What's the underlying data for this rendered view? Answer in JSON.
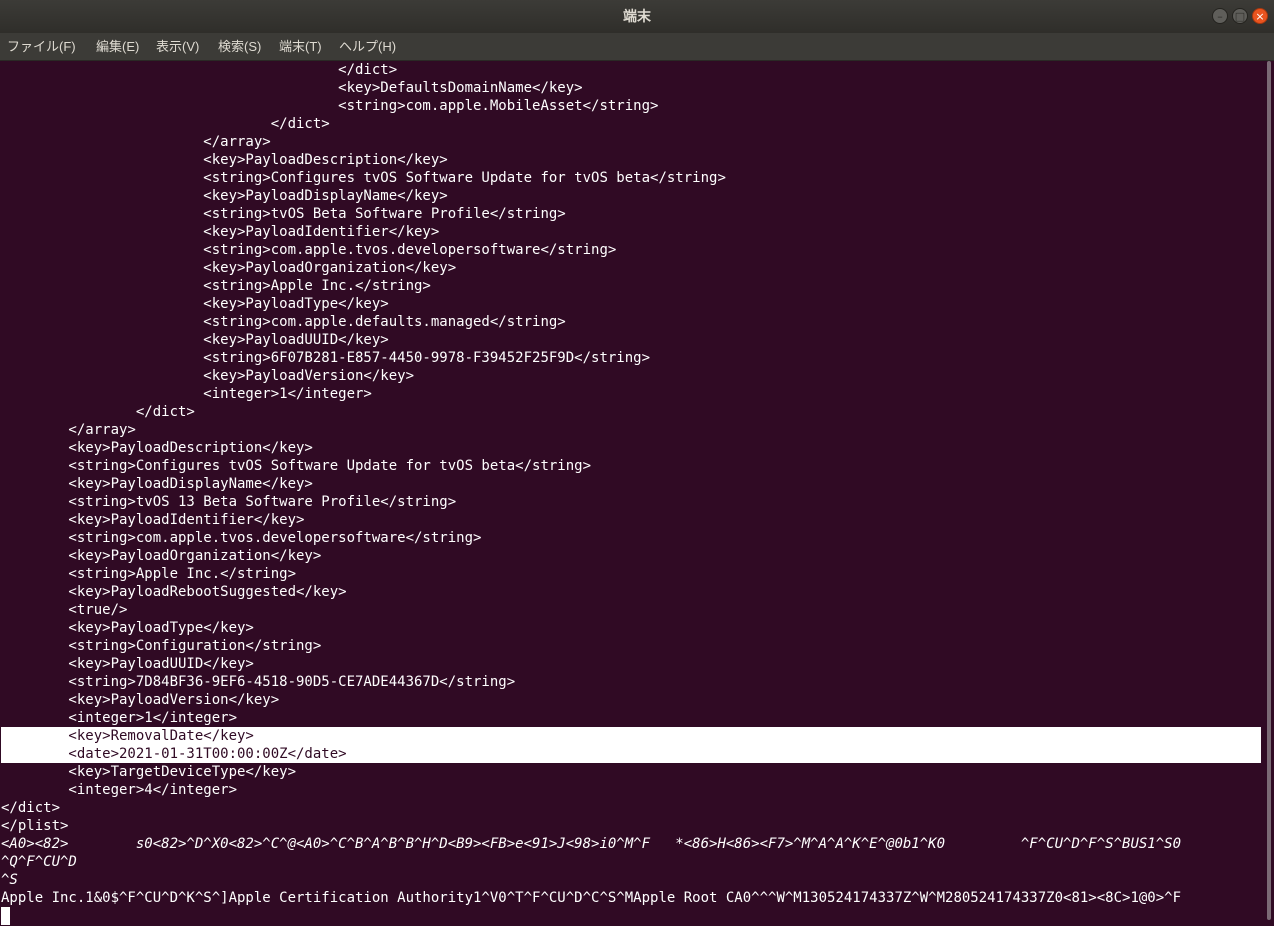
{
  "window": {
    "title": "端末"
  },
  "menu": [
    "ファイル(F)",
    "編集(E)",
    "表示(V)",
    "検索(S)",
    "端末(T)",
    "ヘルプ(H)"
  ],
  "terminal": {
    "lines": [
      "                                        </dict>",
      "                                        <key>DefaultsDomainName</key>",
      "                                        <string>com.apple.MobileAsset</string>",
      "                                </dict>",
      "                        </array>",
      "                        <key>PayloadDescription</key>",
      "                        <string>Configures tvOS Software Update for tvOS beta</string>",
      "                        <key>PayloadDisplayName</key>",
      "                        <string>tvOS Beta Software Profile</string>",
      "                        <key>PayloadIdentifier</key>",
      "                        <string>com.apple.tvos.developersoftware</string>",
      "                        <key>PayloadOrganization</key>",
      "                        <string>Apple Inc.</string>",
      "                        <key>PayloadType</key>",
      "                        <string>com.apple.defaults.managed</string>",
      "                        <key>PayloadUUID</key>",
      "                        <string>6F07B281-E857-4450-9978-F39452F25F9D</string>",
      "                        <key>PayloadVersion</key>",
      "                        <integer>1</integer>",
      "                </dict>",
      "        </array>",
      "        <key>PayloadDescription</key>",
      "        <string>Configures tvOS Software Update for tvOS beta</string>",
      "        <key>PayloadDisplayName</key>",
      "        <string>tvOS 13 Beta Software Profile</string>",
      "        <key>PayloadIdentifier</key>",
      "        <string>com.apple.tvos.developersoftware</string>",
      "        <key>PayloadOrganization</key>",
      "        <string>Apple Inc.</string>",
      "        <key>PayloadRebootSuggested</key>",
      "        <true/>",
      "        <key>PayloadType</key>",
      "        <string>Configuration</string>",
      "        <key>PayloadUUID</key>",
      "        <string>7D84BF36-9EF6-4518-90D5-CE7ADE44367D</string>",
      "        <key>PayloadVersion</key>",
      "        <integer>1</integer>",
      "        <key>RemovalDate</key>",
      "        <date>2021-01-31T00:00:00Z</date>",
      "        <key>TargetDeviceType</key>",
      "        <integer>4</integer>",
      "</dict>",
      "</plist>",
      "<A0><82>        s0<82>^D^X0<82>^C^@<A0>^C^B^A^B^B^H^D<B9><FB>e<91>J<98>i0^M^F   *<86>H<86><F7>^M^A^A^K^E^@0b1^K0         ^F^CU^D^F^S^BUS1^S0",
      "^Q^F^CU^D",
      "^S",
      "Apple Inc.1&0$^F^CU^D^K^S^]Apple Certification Authority1^V0^T^F^CU^D^C^S^MApple Root CA0^^^W^M130524174337Z^W^M280524174337Z0<81><8C>1@0>^F",
      ":"
    ]
  }
}
